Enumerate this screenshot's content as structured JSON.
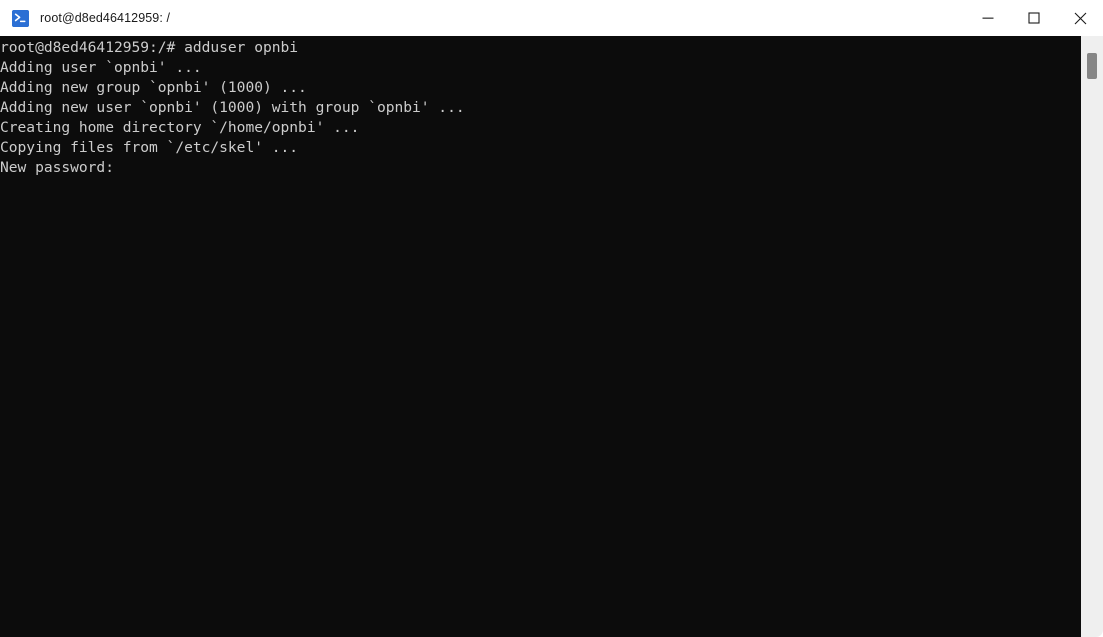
{
  "window": {
    "title": "root@d8ed46412959: /",
    "app_icon": "terminal-prompt-icon",
    "accent_color": "#2b6fd4",
    "titlebar_background": "#ffffff",
    "titlebar_text_color": "#1b1b1b"
  },
  "controls": {
    "minimize_label": "Minimize",
    "maximize_label": "Maximize",
    "close_label": "Close"
  },
  "terminal": {
    "background_color": "#0c0c0c",
    "foreground_color": "#cccccc",
    "lines": [
      "root@d8ed46412959:/# adduser opnbi",
      "Adding user `opnbi' ...",
      "Adding new group `opnbi' (1000) ...",
      "Adding new user `opnbi' (1000) with group `opnbi' ...",
      "Creating home directory `/home/opnbi' ...",
      "Copying files from `/etc/skel' ...",
      "New password:"
    ],
    "prompt": "root@d8ed46412959:/#",
    "command": "adduser opnbi",
    "username": "opnbi",
    "uid": "1000",
    "group": "opnbi",
    "home_directory": "/home/opnbi",
    "skel_directory": "/etc/skel",
    "awaiting_input_label": "New password:"
  },
  "scrollbar": {
    "track_color": "#efefef",
    "thumb_color": "#868686"
  }
}
